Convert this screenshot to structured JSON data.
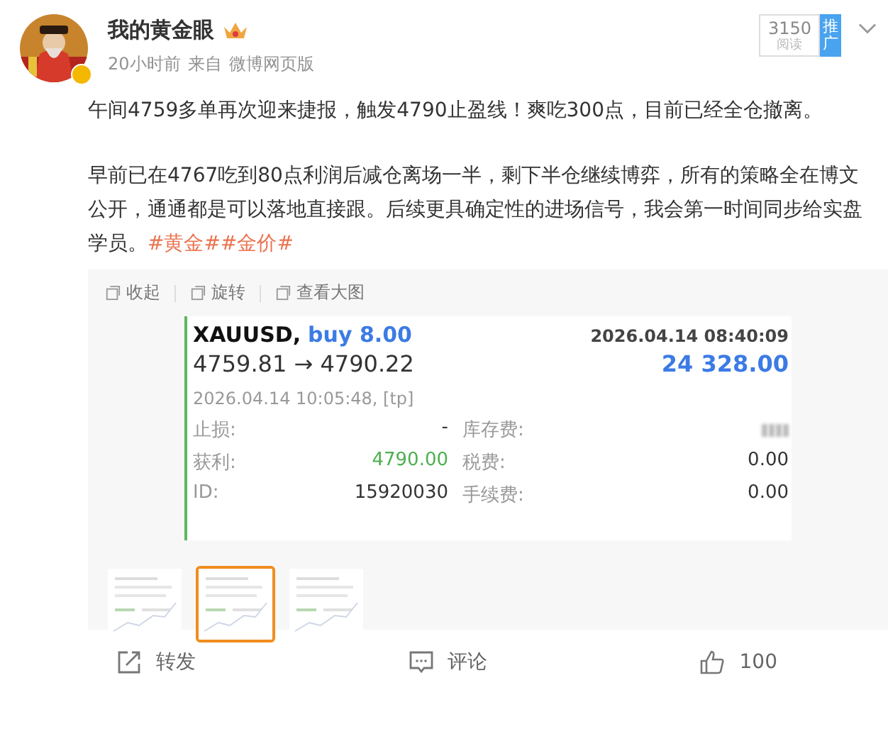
{
  "author": {
    "name": "我的黄金眼",
    "verified": true,
    "time": "20小时前",
    "source_prefix": "来自",
    "source": "微博网页版"
  },
  "reads": {
    "count": "3150",
    "label": "阅读",
    "promote": "推广"
  },
  "post": {
    "paragraphs": [
      "午间4759多单再次迎来捷报，触发4790止盈线！爽吃300点，目前已经全仓撤离。",
      "早前已在4767吃到80点利润后减仓离场一半，剩下半仓继续博弈，所有的策略全在博文公开，通通都是可以落地直接跟。后续更具确定性的进场信号，我会第一时间同步给实盘学员。"
    ],
    "topics": [
      "#黄金#",
      "#金价#"
    ]
  },
  "media_toolbar": [
    "收起",
    "旋转",
    "查看大图"
  ],
  "trade": {
    "symbol": "XAUUSD,",
    "side": "buy 8.00",
    "open_time": "2026.04.14 08:40:09",
    "prices": "4759.81 → 4790.22",
    "profit": "24 328.00",
    "close_time": "2026.04.14 10:05:48, [tp]",
    "fields": [
      {
        "label": "止损:",
        "value": "-",
        "color": "#333333",
        "label2": "库存费:",
        "value2_blurred": true
      },
      {
        "label": "获利:",
        "value": "4790.00",
        "color": "#4caf50",
        "label2": "税费:",
        "value2": "0.00"
      },
      {
        "label": "ID:",
        "value": "15920030",
        "color": "#333333",
        "label2": "手续费:",
        "value2": "0.00"
      }
    ]
  },
  "thumbnails": [
    {
      "kind": "picture",
      "selected": false
    },
    {
      "kind": "picture",
      "selected": true
    },
    {
      "kind": "picture",
      "selected": false
    }
  ],
  "actions": [
    {
      "kind": "repost",
      "label": "转发"
    },
    {
      "kind": "comment",
      "label": "评论"
    },
    {
      "kind": "like",
      "label": "100"
    }
  ]
}
